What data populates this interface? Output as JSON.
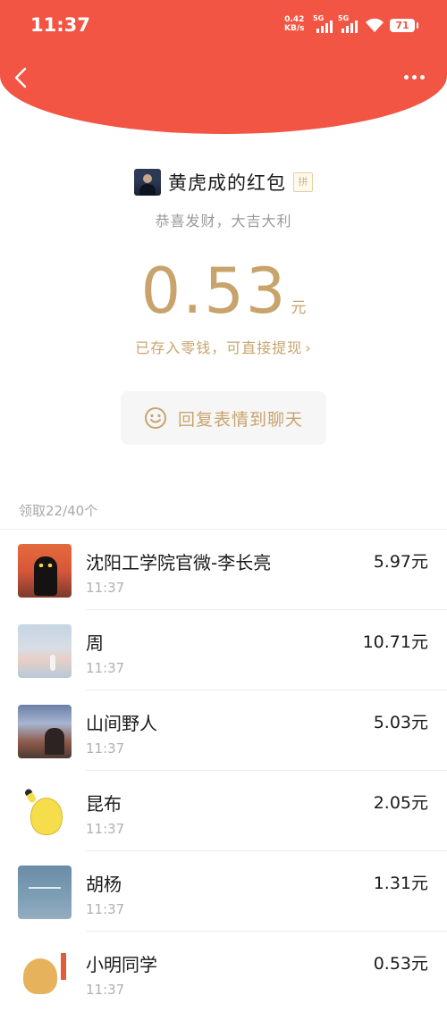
{
  "status_bar": {
    "time": "11:37",
    "net_speed_value": "0.42",
    "net_speed_unit": "KB/s",
    "sim1_gen": "5G",
    "sim2_gen": "5G",
    "battery": "71"
  },
  "colors": {
    "header_red": "#f35545",
    "gold": "#c8a46c"
  },
  "header": {
    "back_icon": "chevron-left-icon",
    "more_icon": "more-dots-icon"
  },
  "packet": {
    "sender_name": "黄虎成的红包",
    "pin_badge": "拼",
    "greeting": "恭喜发财，大吉大利",
    "amount": "0.53",
    "amount_unit": "元",
    "wallet_text": "已存入零钱，可直接提现",
    "wallet_chevron": "›",
    "reply_label": "回复表情到聊天"
  },
  "claims": {
    "count_label": "领取22/40个",
    "items": [
      {
        "name": "沈阳工学院官微-李长亮",
        "time": "11:37",
        "amount": "5.97元"
      },
      {
        "name": "周",
        "time": "11:37",
        "amount": "10.71元"
      },
      {
        "name": "山间野人",
        "time": "11:37",
        "amount": "5.03元"
      },
      {
        "name": "昆布",
        "time": "11:37",
        "amount": "2.05元"
      },
      {
        "name": "胡杨",
        "time": "11:37",
        "amount": "1.31元"
      },
      {
        "name": "小明同学",
        "time": "11:37",
        "amount": "0.53元"
      }
    ]
  }
}
